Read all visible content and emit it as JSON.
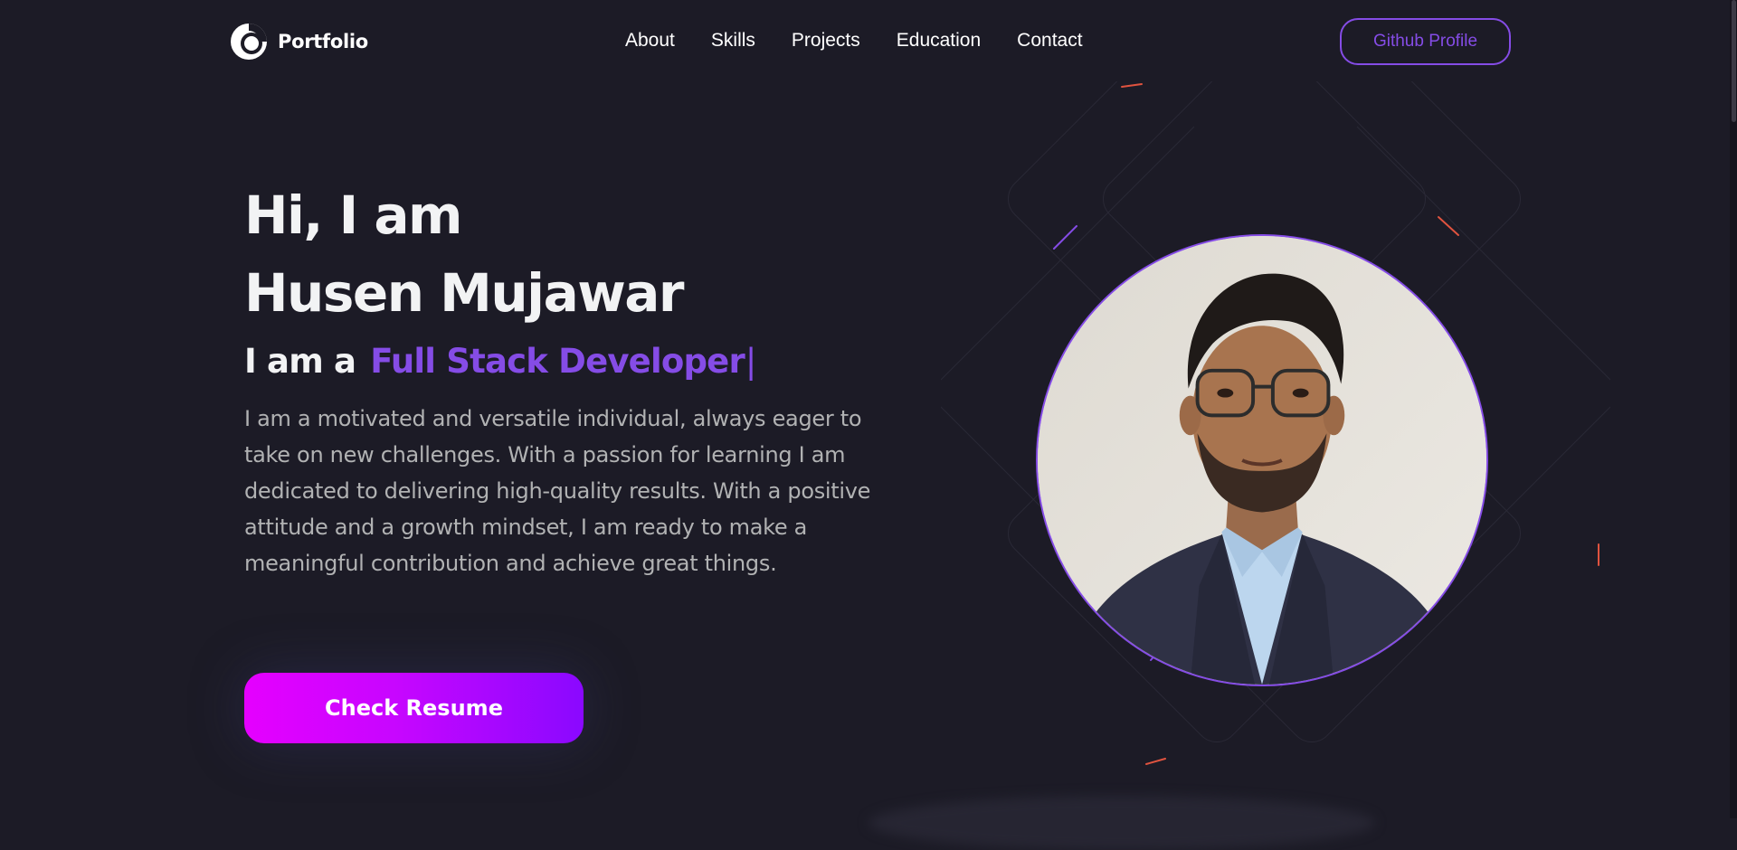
{
  "nav": {
    "logo_text": "Portfolio",
    "links": [
      "About",
      "Skills",
      "Projects",
      "Education",
      "Contact"
    ],
    "github_label": "Github Profile"
  },
  "hero": {
    "greeting": "Hi, I am",
    "name": "Husen Mujawar",
    "role_prefix": "I am a",
    "role_typed": "Full Stack Developer",
    "caret": "|",
    "description": "I am a motivated and versatile individual, always eager to take on new challenges. With a passion for learning I am dedicated to delivering high-quality results. With a positive attitude and a growth mindset, I am ready to make a meaningful contribution and achieve great things.",
    "resume_label": "Check Resume"
  },
  "icons": {
    "logo": "logo-icon",
    "profile_photo": "profile-photo"
  },
  "colors": {
    "background": "#1c1b26",
    "accent": "#854ce6",
    "text_primary": "#f2f3f4",
    "text_secondary": "#b1b2b3",
    "button_gradient_start": "#e500ff",
    "button_gradient_end": "#8a08ff"
  }
}
